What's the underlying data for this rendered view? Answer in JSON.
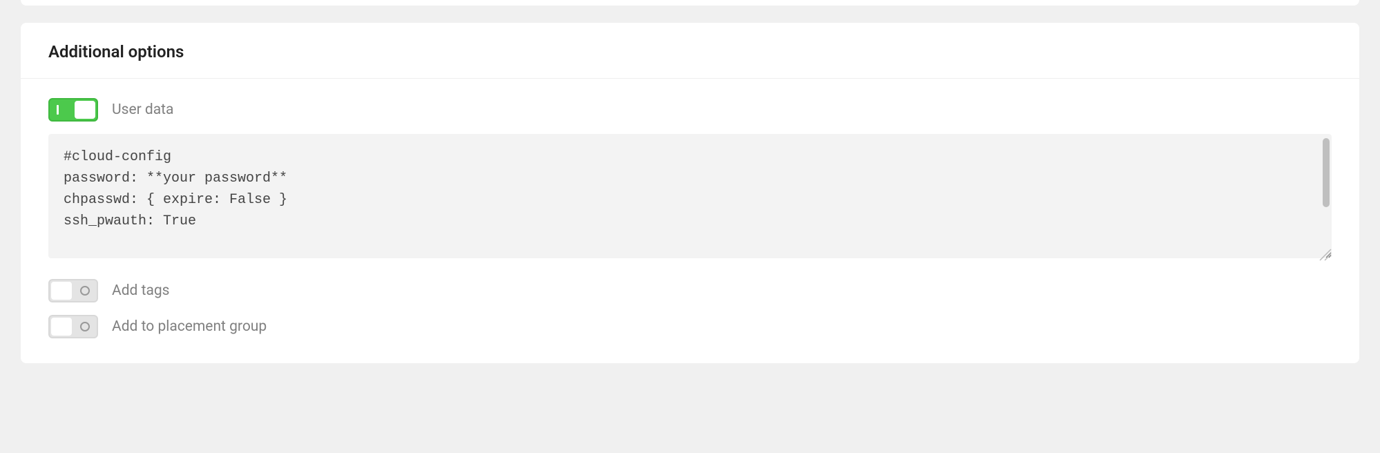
{
  "section": {
    "title": "Additional options"
  },
  "options": {
    "user_data": {
      "label": "User data",
      "enabled": true,
      "value": "#cloud-config\npassword: **your password**\nchpasswd: { expire: False }\nssh_pwauth: True"
    },
    "add_tags": {
      "label": "Add tags",
      "enabled": false
    },
    "placement_group": {
      "label": "Add to placement group",
      "enabled": false
    }
  }
}
